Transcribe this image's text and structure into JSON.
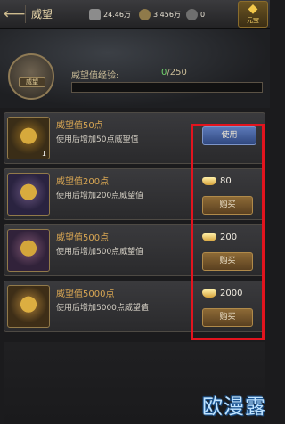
{
  "header": {
    "back_glyph": "⟵",
    "title": "威望",
    "resources": [
      {
        "icon": "silver-icon",
        "value": "24.46万"
      },
      {
        "icon": "copper-icon",
        "value": "3.456万"
      },
      {
        "icon": "gem-icon",
        "value": "0"
      }
    ],
    "gold_label": "元宝"
  },
  "prestige": {
    "emblem_tag": "威望",
    "xp_label": "威望值经验:",
    "xp_current": "0",
    "xp_max": "/250",
    "xp_progress": 0
  },
  "items": [
    {
      "name": "威望值50点",
      "desc": "使用后增加50点威望值",
      "qty": "1",
      "action": "使用",
      "price": null
    },
    {
      "name": "威望值200点",
      "desc": "使用后增加200点威望值",
      "price": "80",
      "action": "购买"
    },
    {
      "name": "威望值500点",
      "desc": "使用后增加500点威望值",
      "price": "200",
      "action": "购买"
    },
    {
      "name": "威望值5000点",
      "desc": "使用后增加5000点威望值",
      "price": "2000",
      "action": "购买"
    }
  ],
  "highlight_color": "#e2141e",
  "watermark": "欧漫露"
}
